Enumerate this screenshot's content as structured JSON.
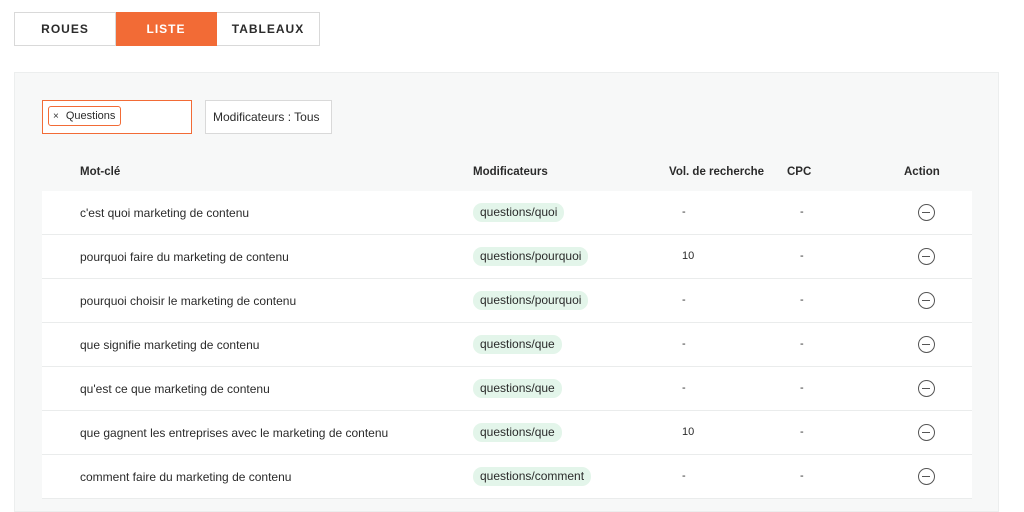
{
  "tabs": [
    {
      "label": "ROUES",
      "active": false
    },
    {
      "label": "LISTE",
      "active": true
    },
    {
      "label": "TABLEAUX",
      "active": false
    }
  ],
  "filter": {
    "chip_remove": "×",
    "chip_label": "Questions",
    "modifiers_button": "Modificateurs : Tous"
  },
  "table": {
    "headers": {
      "keyword": "Mot-clé",
      "modifiers": "Modificateurs",
      "volume": "Vol. de recherche",
      "cpc": "CPC",
      "action": "Action"
    },
    "rows": [
      {
        "keyword": "c'est quoi marketing de contenu",
        "modifier": "questions/quoi",
        "volume": "-",
        "cpc": "-"
      },
      {
        "keyword": "pourquoi faire du marketing de contenu",
        "modifier": "questions/pourquoi",
        "volume": "10",
        "cpc": "-"
      },
      {
        "keyword": "pourquoi choisir le marketing de contenu",
        "modifier": "questions/pourquoi",
        "volume": "-",
        "cpc": "-"
      },
      {
        "keyword": "que signifie marketing de contenu",
        "modifier": "questions/que",
        "volume": "-",
        "cpc": "-"
      },
      {
        "keyword": "qu'est ce que marketing de contenu",
        "modifier": "questions/que",
        "volume": "-",
        "cpc": "-"
      },
      {
        "keyword": "que gagnent les entreprises avec le marketing de contenu",
        "modifier": "questions/que",
        "volume": "10",
        "cpc": "-"
      },
      {
        "keyword": "comment faire du marketing de contenu",
        "modifier": "questions/comment",
        "volume": "-",
        "cpc": "-"
      }
    ]
  },
  "colors": {
    "accent": "#f26b36",
    "badge_bg": "#e3f5ea",
    "panel_bg": "#f7f8f8"
  },
  "icons": {
    "row_action": "remove-circle-icon",
    "chip_remove": "close-icon"
  }
}
